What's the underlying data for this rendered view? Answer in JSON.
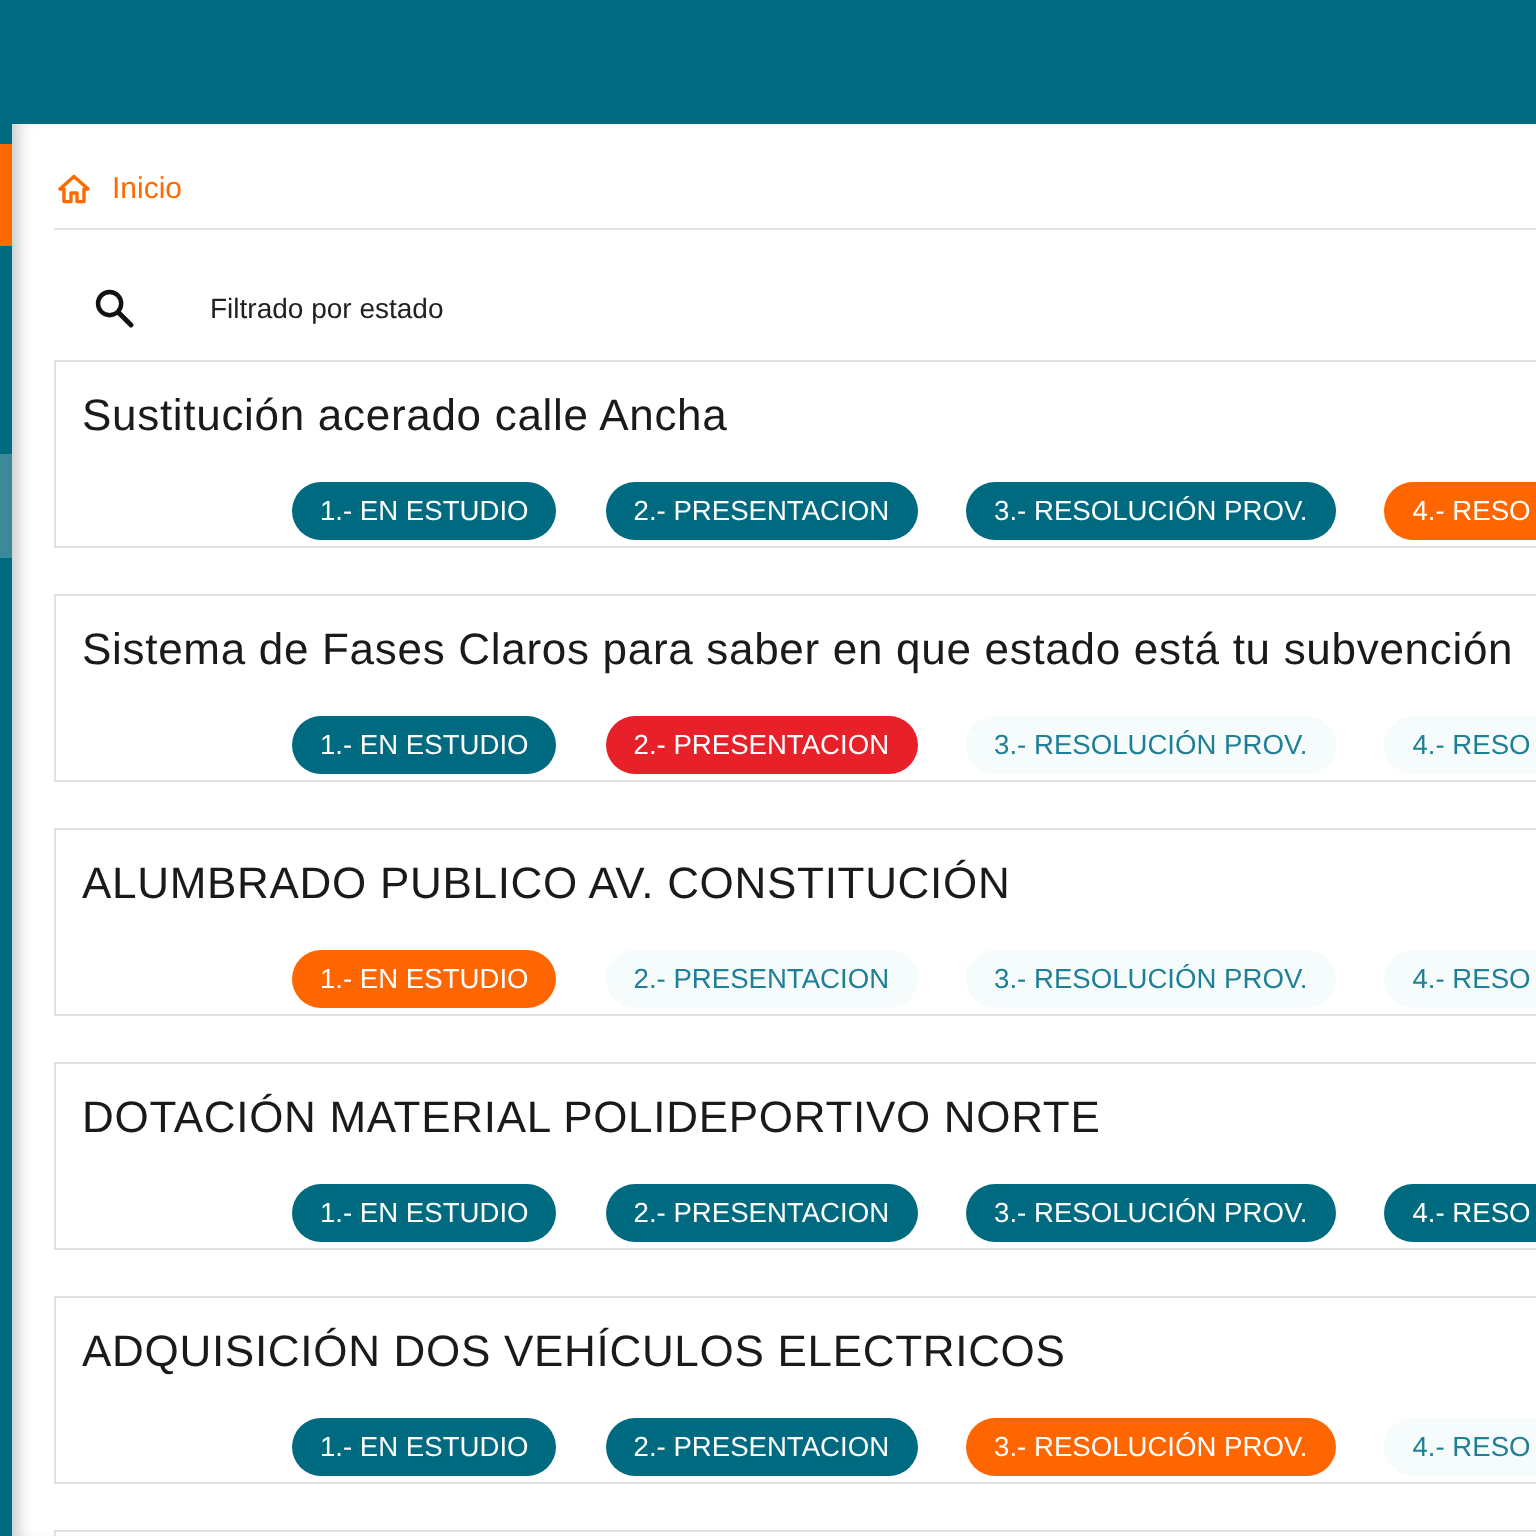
{
  "sidebar": {
    "items": [
      {
        "selected": true,
        "hovered": false
      },
      {
        "selected": false,
        "hovered": false
      },
      {
        "selected": false,
        "hovered": false
      },
      {
        "selected": false,
        "hovered": true
      }
    ]
  },
  "breadcrumb": {
    "label": "Inicio"
  },
  "filter": {
    "label": "Filtrado por estado"
  },
  "projects": [
    {
      "title": "Sustitución acerado calle Ancha",
      "phases": [
        {
          "label": "1.- EN ESTUDIO",
          "kind": "completed"
        },
        {
          "label": "2.- PRESENTACION",
          "kind": "completed"
        },
        {
          "label": "3.- RESOLUCIÓN PROV.",
          "kind": "completed"
        },
        {
          "label": "4.- RESO",
          "kind": "current"
        }
      ]
    },
    {
      "title": "Sistema de Fases Claros para saber en que estado está tu subvención",
      "phases": [
        {
          "label": "1.- EN ESTUDIO",
          "kind": "completed"
        },
        {
          "label": "2.- PRESENTACION",
          "kind": "rejected"
        },
        {
          "label": "3.- RESOLUCIÓN PROV.",
          "kind": "pending"
        },
        {
          "label": "4.- RESO",
          "kind": "pending"
        }
      ]
    },
    {
      "title": "ALUMBRADO PUBLICO AV. CONSTITUCIÓN",
      "phases": [
        {
          "label": "1.- EN ESTUDIO",
          "kind": "current"
        },
        {
          "label": "2.- PRESENTACION",
          "kind": "pending"
        },
        {
          "label": "3.- RESOLUCIÓN PROV.",
          "kind": "pending"
        },
        {
          "label": "4.- RESO",
          "kind": "pending"
        }
      ]
    },
    {
      "title": "DOTACIÓN MATERIAL POLIDEPORTIVO NORTE",
      "phases": [
        {
          "label": "1.- EN ESTUDIO",
          "kind": "completed"
        },
        {
          "label": "2.- PRESENTACION",
          "kind": "completed"
        },
        {
          "label": "3.- RESOLUCIÓN PROV.",
          "kind": "completed"
        },
        {
          "label": "4.- RESO",
          "kind": "completed"
        }
      ]
    },
    {
      "title": "ADQUISICIÓN DOS VEHÍCULOS ELECTRICOS",
      "phases": [
        {
          "label": "1.- EN ESTUDIO",
          "kind": "completed"
        },
        {
          "label": "2.- PRESENTACION",
          "kind": "completed"
        },
        {
          "label": "3.- RESOLUCIÓN PROV.",
          "kind": "current"
        },
        {
          "label": "4.- RESO",
          "kind": "pending"
        }
      ]
    }
  ]
}
